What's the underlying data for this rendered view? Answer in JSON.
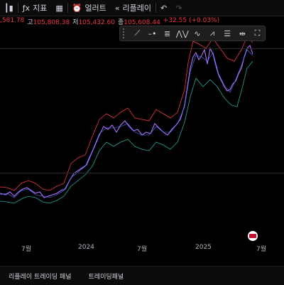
{
  "toolbar": {
    "indicator_label": "지표",
    "alert_label": "얼러트",
    "replay_label": "리플레이"
  },
  "ohlc": {
    "open_partial": ",581.78",
    "high_label": "고",
    "high": "105,808.38",
    "low_label": "저",
    "low": "105,432.60",
    "close_label": "종",
    "close": "105,608.44",
    "change": "+32.55 (+0.03%)"
  },
  "time_axis": [
    "7월",
    "2024",
    "7월",
    "2025",
    "7월"
  ],
  "bottom_tabs": [
    "리플레이 트레이딩 패널",
    "트레이딩패널"
  ],
  "colors": {
    "upper_band": "#f23645",
    "lower_band": "#26a69a",
    "price": "#b070ff",
    "price_alt": "#4f7dff"
  }
}
